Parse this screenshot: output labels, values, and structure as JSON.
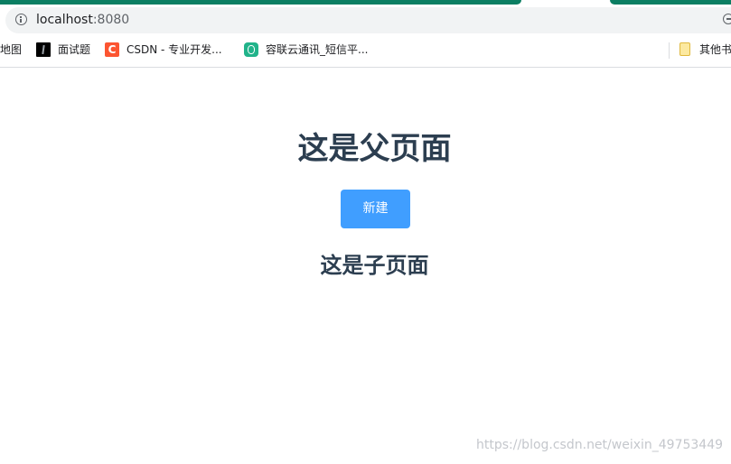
{
  "browser": {
    "url_host": "localhost",
    "url_port": ":8080",
    "bookmarks": [
      {
        "label": "地图"
      },
      {
        "label": "面试题",
        "icon": "dark-image-icon"
      },
      {
        "label": "CSDN - 专业开发...",
        "icon": "csdn-icon",
        "icon_letter": "C"
      },
      {
        "label": "容联云通讯_短信平...",
        "icon": "ronglian-icon"
      },
      {
        "label": "其他书",
        "icon": "folder-icon"
      }
    ],
    "colors": {
      "tab_strip": "#0b7e62",
      "omnibox_bg": "#f1f3f4"
    }
  },
  "page": {
    "parent_title": "这是父页面",
    "new_button_label": "新建",
    "child_title": "这是子页面",
    "watermark": "https://blog.csdn.net/weixin_49753449",
    "colors": {
      "heading": "#2c3e50",
      "button": "#409eff"
    }
  }
}
